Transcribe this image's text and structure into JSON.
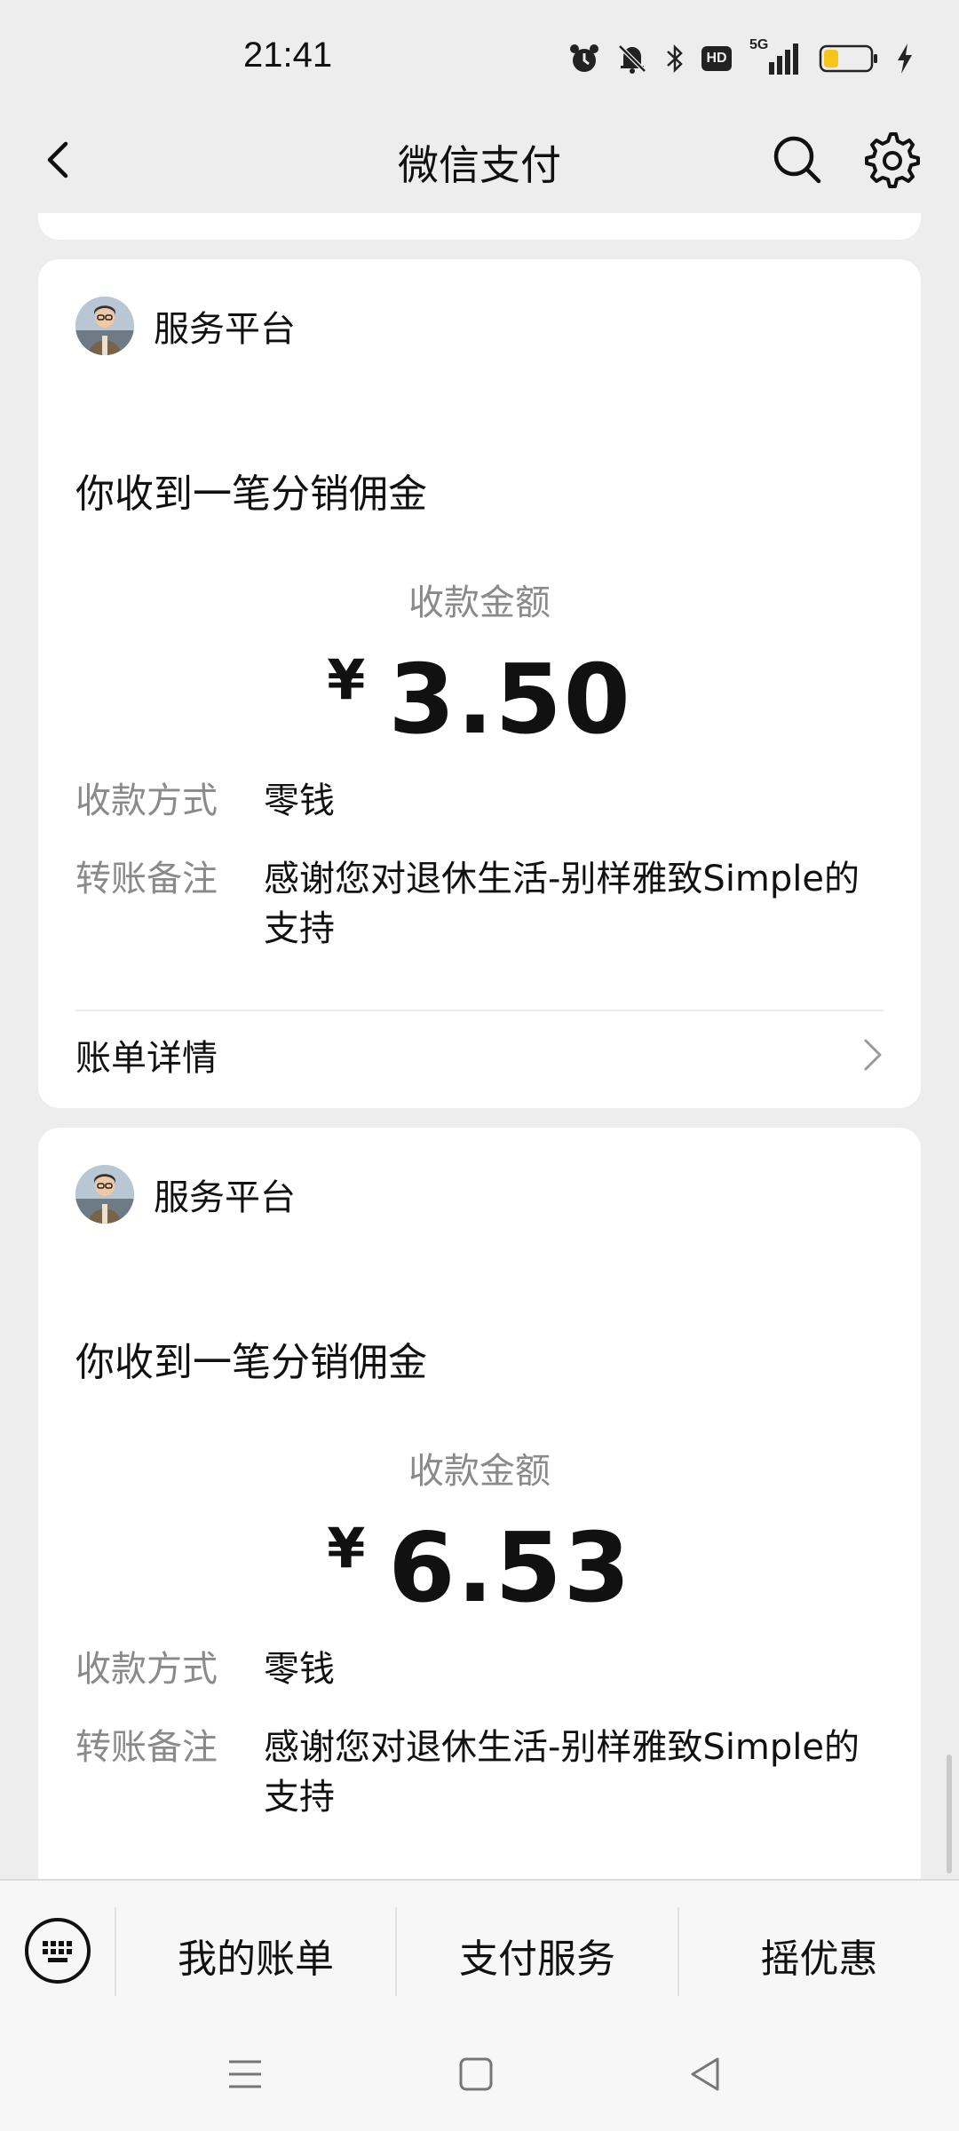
{
  "status_bar": {
    "time": "21:41",
    "icons": [
      "alarm-icon",
      "mute-icon",
      "bluetooth-icon",
      "hd-icon",
      "5g-signal-icon",
      "battery-low-icon",
      "charging-icon"
    ],
    "network_label": "5G",
    "hd_label": "HD"
  },
  "nav": {
    "title": "微信支付",
    "back_icon": "chevron-left-icon",
    "search_icon": "search-icon",
    "settings_icon": "gear-icon"
  },
  "cards": [
    {
      "sender": "服务平台",
      "title": "你收到一笔分销佣金",
      "amount_label": "收款金额",
      "currency": "¥",
      "amount": "3.50",
      "method_label": "收款方式",
      "method_value": "零钱",
      "note_label": "转账备注",
      "note_value": "感谢您对退休生活-别样雅致Simple的支持",
      "details_label": "账单详情"
    },
    {
      "sender": "服务平台",
      "title": "你收到一笔分销佣金",
      "amount_label": "收款金额",
      "currency": "¥",
      "amount": "6.53",
      "method_label": "收款方式",
      "method_value": "零钱",
      "note_label": "转账备注",
      "note_value": "感谢您对退休生活-别样雅致Simple的支持"
    }
  ],
  "bottom_menu": {
    "keyboard_icon": "keyboard-icon",
    "items": [
      "我的账单",
      "支付服务",
      "摇优惠"
    ]
  },
  "system_nav": {
    "icons": [
      "menu-icon",
      "home-icon",
      "back-triangle-icon"
    ]
  },
  "colors": {
    "background": "#ededed",
    "card": "#ffffff",
    "muted_text": "#8a8a8a",
    "battery_fill": "#f5c518"
  }
}
